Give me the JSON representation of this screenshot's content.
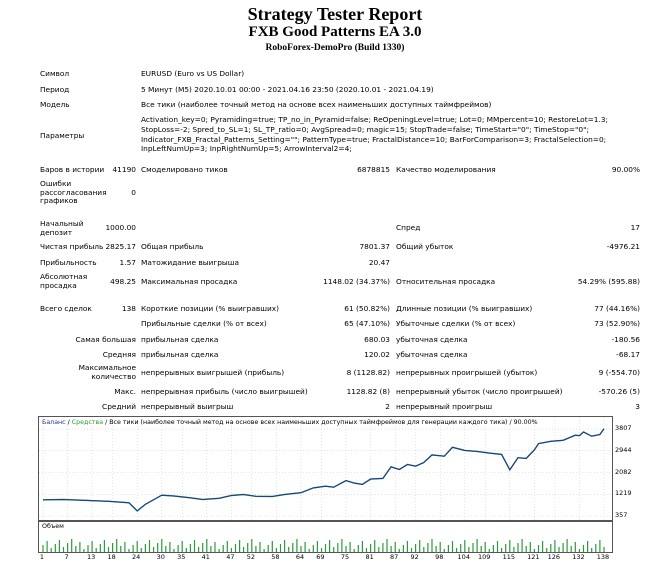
{
  "header": {
    "title": "Strategy Tester Report",
    "subtitle": "FXB Good Patterns EA 3.0",
    "server": "RoboForex-DemoPro (Build 1330)"
  },
  "info": {
    "symbol_label": "Символ",
    "symbol_value": "EURUSD (Euro vs US Dollar)",
    "period_label": "Период",
    "period_value": "5 Минут (M5) 2020.10.01 00:00 - 2021.04.16 23:50 (2020.10.01 - 2021.04.19)",
    "model_label": "Модель",
    "model_value": "Все тики (наиболее точный метод на основе всех наименьших доступных таймфреймов)",
    "params_label": "Параметры",
    "params_value": "Activation_key=0; Pyramiding=true; TP_no_in_Pyramid=false; ReOpeningLevel=true; Lot=0; MMpercent=10; RestoreLot=1.3; StopLoss=-2; Spred_to_SL=1; SL_TP_ratio=0; AvgSpread=0; magic=15; StopTrade=false; TimeStart=\"0\"; TimeStop=\"0\"; Indicator_FXB_Fractal_Patterns_Setting=\"\"; PatternType=true; FractalDistance=10; BarForComparison=3; FractalSelection=0; InpLeftNumUp=3; InpRightNumUp=5; ArrowInterval2=4;"
  },
  "stats": {
    "bars_label": "Баров в истории",
    "bars_value": "41190",
    "ticks_label": "Смоделировано тиков",
    "ticks_value": "6878815",
    "quality_label": "Качество моделирования",
    "quality_value": "90.00%",
    "errors_label": "Ошибки рассогласования графиков",
    "errors_value": "0",
    "deposit_label": "Начальный депозит",
    "deposit_value": "1000.00",
    "spread_label": "Спред",
    "spread_value": "17",
    "net_label": "Чистая прибыль",
    "net_value": "2825.17",
    "gross_profit_label": "Общая прибыль",
    "gross_profit_value": "7801.37",
    "gross_loss_label": "Общий убыток",
    "gross_loss_value": "-4976.21",
    "pf_label": "Прибыльность",
    "pf_value": "1.57",
    "payoff_label": "Матожидание выигрыша",
    "payoff_value": "20.47",
    "abs_dd_label": "Абсолютная просадка",
    "abs_dd_value": "498.25",
    "max_dd_label": "Максимальная просадка",
    "max_dd_value": "1148.02 (34.37%)",
    "rel_dd_label": "Относительная просадка",
    "rel_dd_value": "54.29% (595.88)",
    "total_label": "Всего сделок",
    "total_value": "138",
    "short_label": "Короткие позиции (% выигравших)",
    "short_value": "61 (50.82%)",
    "long_label": "Длинные позиции (% выигравших)",
    "long_value": "77 (44.16%)",
    "profit_trades_label": "Прибыльные сделки (% от всех)",
    "profit_trades_value": "65 (47.10%)",
    "loss_trades_label": "Убыточные сделки (% от всех)",
    "loss_trades_value": "73 (52.90%)",
    "largest_label": "Самая большая",
    "largest_profit_label": "прибыльная сделка",
    "largest_profit_value": "680.03",
    "largest_loss_label": "убыточная сделка",
    "largest_loss_value": "-180.56",
    "average_label": "Средняя",
    "average_profit_label": "прибыльная сделка",
    "average_profit_value": "120.02",
    "average_loss_label": "убыточная сделка",
    "average_loss_value": "-68.17",
    "max_count_label": "Максимальное количество",
    "max_cons_wins_label": "непрерывных выигрышей (прибыль)",
    "max_cons_wins_value": "8 (1128.82)",
    "max_cons_losses_label": "непрерывных проигрышей (убыток)",
    "max_cons_losses_value": "9 (-554.70)",
    "max_label": "Макс.",
    "max_cons_profit_label": "непрерывная прибыль (число выигрышей)",
    "max_cons_profit_value": "1128.82 (8)",
    "max_cons_loss_label": "непрерывный убыток (число проигрышей)",
    "max_cons_loss_value": "-570.26 (5)",
    "avg_label": "Средний",
    "avg_cons_wins_label": "непрерывный выигрыш",
    "avg_cons_wins_value": "2",
    "avg_cons_losses_label": "непрерывный проигрыш",
    "avg_cons_losses_value": "3"
  },
  "chart_data": {
    "type": "line",
    "legend_balance": "Баланс",
    "legend_sep1": " / ",
    "legend_equity": "Средства",
    "legend_rest": " / Все тики (наиболее точный метод на основе всех наименьших доступных таймфреймов для генерации каждого тика) / 90.00%",
    "volume_label": "Объем",
    "colors": {
      "balance": "#1f3a93",
      "equity": "#2e9b3a",
      "volume": "#2e9b3a"
    },
    "yticks": [
      "3807",
      "2944",
      "2082",
      "1219",
      "357"
    ],
    "ylim": [
      357,
      3807
    ],
    "xticks": [
      "1",
      "7",
      "13",
      "18",
      "24",
      "30",
      "35",
      "41",
      "47",
      "52",
      "58",
      "64",
      "69",
      "75",
      "81",
      "87",
      "92",
      "98",
      "104",
      "109",
      "115",
      "121",
      "126",
      "132",
      "138"
    ],
    "xlim": [
      1,
      138
    ],
    "balance": [
      [
        1,
        1000
      ],
      [
        6,
        1010
      ],
      [
        11,
        980
      ],
      [
        17,
        940
      ],
      [
        22,
        880
      ],
      [
        24,
        560
      ],
      [
        26,
        820
      ],
      [
        30,
        1180
      ],
      [
        33,
        1150
      ],
      [
        37,
        1080
      ],
      [
        40,
        1010
      ],
      [
        44,
        1060
      ],
      [
        47,
        1170
      ],
      [
        50,
        1210
      ],
      [
        53,
        1140
      ],
      [
        57,
        1130
      ],
      [
        60,
        1210
      ],
      [
        64,
        1280
      ],
      [
        67,
        1470
      ],
      [
        70,
        1540
      ],
      [
        72,
        1500
      ],
      [
        75,
        1760
      ],
      [
        77,
        1660
      ],
      [
        79,
        1610
      ],
      [
        81,
        1820
      ],
      [
        84,
        1850
      ],
      [
        86,
        2310
      ],
      [
        88,
        2200
      ],
      [
        90,
        2400
      ],
      [
        92,
        2330
      ],
      [
        94,
        2480
      ],
      [
        96,
        2780
      ],
      [
        99,
        2730
      ],
      [
        101,
        3080
      ],
      [
        104,
        2960
      ],
      [
        107,
        2920
      ],
      [
        110,
        2850
      ],
      [
        113,
        2800
      ],
      [
        115,
        2190
      ],
      [
        117,
        2670
      ],
      [
        119,
        2640
      ],
      [
        121,
        2980
      ],
      [
        122,
        3230
      ],
      [
        125,
        3320
      ],
      [
        128,
        3360
      ],
      [
        131,
        3560
      ],
      [
        132,
        3540
      ],
      [
        133,
        3690
      ],
      [
        135,
        3520
      ],
      [
        137,
        3590
      ],
      [
        138,
        3820
      ]
    ],
    "equity": [
      [
        1,
        1000
      ],
      [
        6,
        1010
      ],
      [
        11,
        980
      ],
      [
        17,
        940
      ],
      [
        22,
        880
      ],
      [
        24,
        560
      ],
      [
        26,
        820
      ],
      [
        30,
        1180
      ],
      [
        33,
        1150
      ],
      [
        37,
        1080
      ],
      [
        40,
        1010
      ],
      [
        44,
        1060
      ],
      [
        47,
        1170
      ],
      [
        50,
        1210
      ],
      [
        53,
        1140
      ],
      [
        57,
        1130
      ],
      [
        60,
        1210
      ],
      [
        64,
        1280
      ],
      [
        67,
        1470
      ],
      [
        70,
        1540
      ],
      [
        72,
        1500
      ],
      [
        75,
        1760
      ],
      [
        77,
        1660
      ],
      [
        79,
        1610
      ],
      [
        81,
        1820
      ],
      [
        84,
        1850
      ],
      [
        86,
        2310
      ],
      [
        88,
        2200
      ],
      [
        90,
        2400
      ],
      [
        92,
        2330
      ],
      [
        94,
        2480
      ],
      [
        96,
        2780
      ],
      [
        99,
        2730
      ],
      [
        101,
        3080
      ],
      [
        104,
        2960
      ],
      [
        107,
        2920
      ],
      [
        110,
        2850
      ],
      [
        113,
        2800
      ],
      [
        115,
        2190
      ],
      [
        117,
        2670
      ],
      [
        119,
        2640
      ],
      [
        121,
        2980
      ],
      [
        122,
        3230
      ],
      [
        125,
        3320
      ],
      [
        128,
        3360
      ],
      [
        131,
        3560
      ],
      [
        132,
        3540
      ],
      [
        133,
        3690
      ],
      [
        135,
        3520
      ],
      [
        137,
        3590
      ],
      [
        138,
        3820
      ]
    ]
  }
}
